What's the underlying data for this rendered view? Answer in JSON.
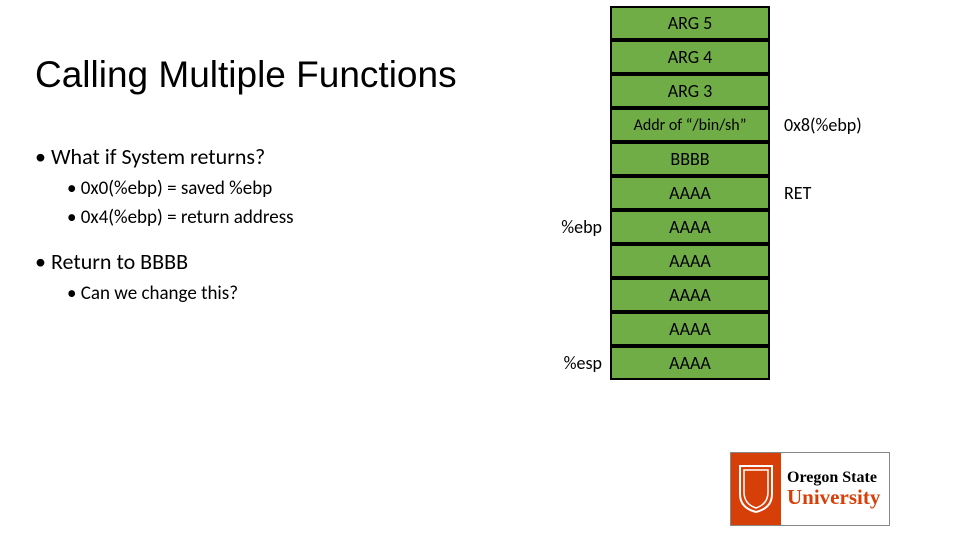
{
  "title": "Calling Multiple Functions",
  "bullets": {
    "q1": "What if System returns?",
    "q1a": "0x0(%ebp) = saved %ebp",
    "q1b": "0x4(%ebp) = return address",
    "q2": "Return to BBBB",
    "q2a": "Can we change this?"
  },
  "stack": {
    "rows": [
      {
        "text": "ARG 5",
        "left": "",
        "right": ""
      },
      {
        "text": "ARG 4",
        "left": "",
        "right": ""
      },
      {
        "text": "ARG 3",
        "left": "",
        "right": ""
      },
      {
        "text": "Addr of “/bin/sh”",
        "left": "",
        "right": "0x8(%ebp)"
      },
      {
        "text": "BBBB",
        "left": "",
        "right": ""
      },
      {
        "text": "AAAA",
        "left": "",
        "right": "RET"
      },
      {
        "text": "AAAA",
        "left": "%ebp",
        "right": ""
      },
      {
        "text": "AAAA",
        "left": "",
        "right": ""
      },
      {
        "text": "AAAA",
        "left": "",
        "right": ""
      },
      {
        "text": "AAAA",
        "left": "",
        "right": ""
      },
      {
        "text": "AAAA",
        "left": "%esp",
        "right": ""
      }
    ]
  },
  "logo": {
    "line1": "Oregon State",
    "line2": "University"
  }
}
